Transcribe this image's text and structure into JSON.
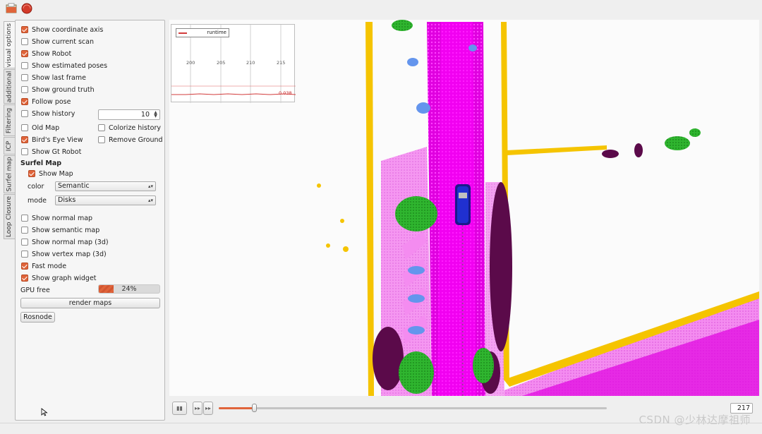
{
  "toolbar": {
    "open_icon": "open-folder-icon",
    "record_icon": "record-icon"
  },
  "tabs": [
    {
      "label": "visual options"
    },
    {
      "label": "additional"
    },
    {
      "label": "Filtering"
    },
    {
      "label": "ICP"
    },
    {
      "label": "Surfel map"
    },
    {
      "label": "Loop Closure"
    }
  ],
  "options": {
    "show_coordinate_axis": {
      "label": "Show coordinate axis",
      "checked": true
    },
    "show_current_scan": {
      "label": "Show current scan",
      "checked": false
    },
    "show_robot": {
      "label": "Show Robot",
      "checked": true
    },
    "show_estimated_poses": {
      "label": "Show estimated poses",
      "checked": false
    },
    "show_last_frame": {
      "label": "Show last frame",
      "checked": false
    },
    "show_ground_truth": {
      "label": "Show ground truth",
      "checked": false
    },
    "follow_pose": {
      "label": "Follow pose",
      "checked": true
    },
    "show_history": {
      "label": "Show history",
      "checked": false,
      "value": "10"
    },
    "old_map": {
      "label": "Old Map",
      "checked": false
    },
    "colorize_history": {
      "label": "Colorize history",
      "checked": false
    },
    "birds_eye_view": {
      "label": "Bird's Eye View",
      "checked": true
    },
    "remove_ground": {
      "label": "Remove Ground",
      "checked": false
    },
    "show_gt_robot": {
      "label": "Show Gt Robot",
      "checked": false
    }
  },
  "surfel": {
    "title": "Surfel Map",
    "show_map": {
      "label": "Show Map",
      "checked": true
    },
    "color_label": "color",
    "color_value": "Semantic",
    "mode_label": "mode",
    "mode_value": "Disks"
  },
  "maps": {
    "show_normal_map": {
      "label": "Show normal map",
      "checked": false
    },
    "show_semantic_map": {
      "label": "Show semantic map",
      "checked": false
    },
    "show_normal_map_3d": {
      "label": "Show normal map (3d)",
      "checked": false
    },
    "show_vertex_map_3d": {
      "label": "Show vertex map (3d)",
      "checked": false
    },
    "fast_mode": {
      "label": "Fast mode",
      "checked": true
    },
    "show_graph_widget": {
      "label": "Show graph widget",
      "checked": true
    }
  },
  "gpu": {
    "label": "GPU free",
    "percent": 24,
    "text": "24%"
  },
  "buttons": {
    "render_maps": "render maps",
    "rosnode": "Rosnode"
  },
  "graph": {
    "legend": "runtime",
    "ticks": [
      "200",
      "205",
      "210",
      "215"
    ],
    "current_value": "0.038"
  },
  "playback": {
    "pause_icon": "pause-icon",
    "step_icon": "step-forward-icon",
    "end_icon": "skip-to-end-icon",
    "progress": 0.09,
    "frame": "217"
  },
  "watermark": "CSDN @少林达摩祖师",
  "colors": {
    "accent": "#e0643a",
    "road": "#ff00ff",
    "sidewalk": "#f36cf3",
    "building": "#f5c400",
    "vegetation": "#20b020",
    "car": "#2030d0",
    "fence": "#5b0a4a",
    "pole": "#6495ed"
  }
}
